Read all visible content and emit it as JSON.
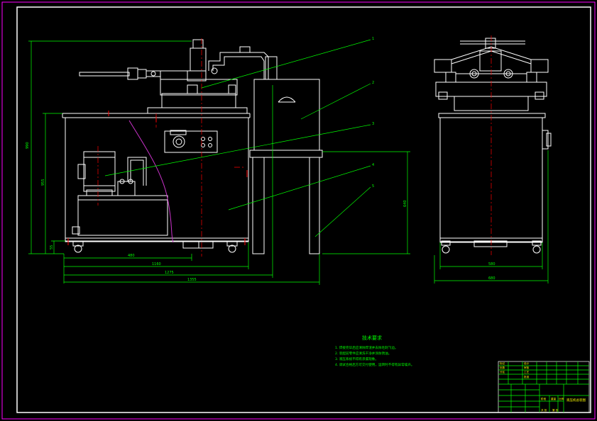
{
  "drawing": {
    "colors": {
      "background": "#000000",
      "outer_border": "#ff00ff",
      "frame": "#ffffff",
      "dimension": "#00ff00",
      "centerline": "#ff0000",
      "curve": "#cc33cc",
      "title_block": "#00ff00",
      "text_yellow": "#ffff00"
    },
    "balloons": [
      "1",
      "2",
      "3",
      "4",
      "5"
    ],
    "front_dims": {
      "overall_height": "990",
      "left_height": "955",
      "base_height": "55",
      "width_a": "480",
      "width_b": "1160",
      "width_c": "1275",
      "width_d": "1355",
      "stand_height": "640"
    },
    "side_dims": {
      "body_width": "580",
      "overall_width": "680"
    },
    "tech_req": {
      "title": "技术要求",
      "notes": [
        "1. 焊接完毕后应清除焊渣并去除毛刺飞边。",
        "2. 装配前零件应清洗干净并涂防锈油。",
        "3. 液压系统不得有渗漏现象。",
        "4. 调试合格后方可交付使用，运转时不得有异常噪声。"
      ]
    },
    "title_block": {
      "drawing_name": "液压机总装图",
      "cells": [
        "标记",
        "处数",
        "分区",
        "设计",
        "审核",
        "工艺",
        "批准",
        "阶段",
        "重量",
        "比例",
        "共 张",
        "第 张"
      ]
    }
  }
}
